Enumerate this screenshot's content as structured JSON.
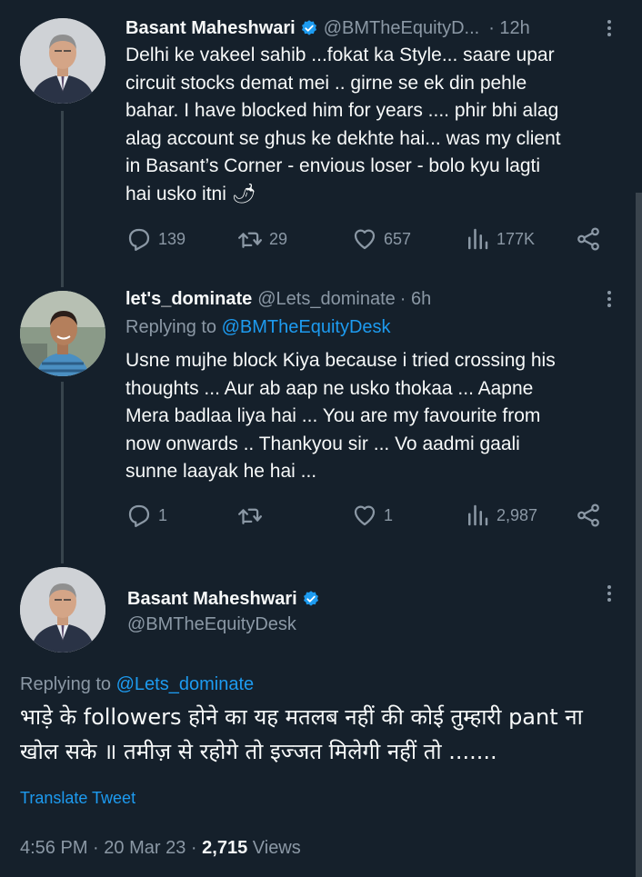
{
  "tweets": [
    {
      "name": "Basant Maheshwari",
      "handle": "@BMTheEquityD...",
      "time": "· 12h",
      "lines": [
        "Delhi ke vakeel sahib ...fokat ka Style... saare upar",
        "circuit stocks demat mei .. girne se ek din pehle",
        "bahar. I have blocked him for years .... phir bhi alag",
        "alag account se ghus ke dekhte hai... was my client",
        "in Basant’s Corner - envious loser - bolo kyu lagti",
        "hai usko itni"
      ],
      "emoji": "🌶",
      "replies": "139",
      "retweets": "29",
      "likes": "657",
      "views": "177K"
    },
    {
      "name": "let's_dominate",
      "handle": "@Lets_dominate",
      "time": "· 6h",
      "replying_prefix": "Replying to",
      "replying_to": "@BMTheEquityDesk",
      "lines": [
        "Usne mujhe block Kiya because i tried crossing his",
        "thoughts ... Aur ab aap ne usko thokaa ... Aapne",
        "Mera badlaa liya hai ... You are my favourite from",
        "now onwards .. Thankyou sir ... Vo aadmi gaali",
        "sunne laayak he hai ..."
      ],
      "replies": "1",
      "retweets": "",
      "likes": "1",
      "views": "2,987"
    }
  ],
  "main_tweet": {
    "name": "Basant Maheshwari",
    "handle": "@BMTheEquityDesk",
    "replying_prefix": "Replying to",
    "replying_to": "@Lets_dominate",
    "lines": [
      "भाड़े के followers होने का यह मतलब नहीं की कोई तुम्हारी pant ना",
      "खोल सके ॥ तमीज़ से रहोगे तो इज्जत मिलेगी नहीं तो ......."
    ],
    "translate": "Translate Tweet",
    "time": "4:56 PM",
    "date": "20 Mar 23",
    "sep": "·",
    "views_count": "2,715",
    "views_label": "Views"
  },
  "colors": {
    "background": "#15202b",
    "text": "#f7f9f9",
    "muted": "#8b98a5",
    "link": "#1d9bf0",
    "verified": "#1d9bf0"
  },
  "icons": [
    "reply-icon",
    "retweet-icon",
    "like-icon",
    "views-icon",
    "share-icon",
    "verified-badge-icon",
    "more-icon"
  ]
}
